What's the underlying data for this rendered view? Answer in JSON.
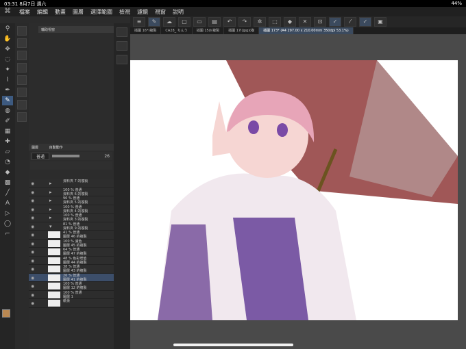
{
  "status": {
    "time": "03:31",
    "date": "8月7日 週六",
    "battery": "44%"
  },
  "menu": [
    "檔案",
    "編輯",
    "動畫",
    "圖層",
    "選擇範圍",
    "檢視",
    "濾鏡",
    "視窗",
    "說明"
  ],
  "tabs": [
    {
      "label": "插圖 16*(複製"
    },
    {
      "label": "CA28_ ちんう"
    },
    {
      "label": "插圖 15(I(複製"
    },
    {
      "label": "插圖 17I(jpg)(複"
    },
    {
      "label": "插圖 173* (A4 297.00 x 210.00mm 350dpi 53.1%)"
    }
  ],
  "panel_title": "輔助視窗",
  "layer_panel": {
    "title": "圖層",
    "tab2": "自動動作",
    "blend_mode": "普通",
    "opacity": "26"
  },
  "layers": [
    {
      "text1": "資料夾 7 的複製",
      "text2": ""
    },
    {
      "text1": "100 % 普通",
      "text2": "資料夾 6 的複製"
    },
    {
      "text1": "96 % 普通",
      "text2": "資料夾 5 的複製"
    },
    {
      "text1": "100 % 普通",
      "text2": "資料夾 4 的複製"
    },
    {
      "text1": "100 % 普通",
      "text2": "資料夾 3 的複製"
    },
    {
      "text1": "81 % 普通",
      "text2": "資料夾 9 的複製"
    },
    {
      "text1": "41 % 普通",
      "text2": "圖層 46 的複製"
    },
    {
      "text1": "100 % 濾色",
      "text2": "圖層 45 的複製"
    },
    {
      "text1": "64 % 普通",
      "text2": "圖層 47 的複製"
    },
    {
      "text1": "48 % 色彩增值",
      "text2": "圖層 44 的複製"
    },
    {
      "text1": "38 % 普通",
      "text2": "圖層 43 的複製"
    },
    {
      "text1": "26 % 普通",
      "text2": "圖層 41 的複製"
    },
    {
      "text1": "100 % 普通",
      "text2": "圖層 12 的複製"
    },
    {
      "text1": "100 % 普通",
      "text2": "圖層 1"
    },
    {
      "text1": "紙張",
      "text2": ""
    }
  ],
  "colors": {
    "accent": "#3d5a80",
    "selected_layer": "#3c4e6a",
    "main_color": "#b98852"
  }
}
